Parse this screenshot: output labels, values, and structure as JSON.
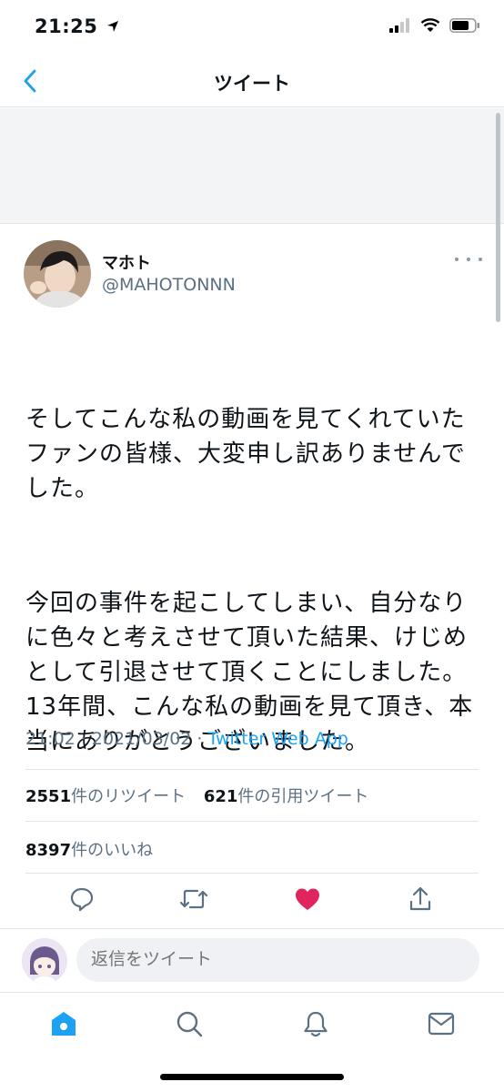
{
  "status_bar": {
    "time": "21:25"
  },
  "nav": {
    "title": "ツイート"
  },
  "tweet": {
    "display_name": "マホト",
    "handle": "@MAHOTONNN",
    "paragraph_1": "そしてこんな私の動画を見てくれていたファンの皆様、大変申し訳ありませんでした。",
    "paragraph_2": "今回の事件を起こしてしまい、自分なりに色々と考えさせて頂いた結果、けじめとして引退させて頂くことにしました。\n13年間、こんな私の動画を見て頂き、本当にありがとうございました。",
    "timestamp": "21:02 · 2021/03/02 · ",
    "source": "Twitter Web App"
  },
  "stats": {
    "retweet_count": "2551",
    "retweet_label": "件のリツイート",
    "quote_count": "621",
    "quote_label": "件の引用ツイート",
    "like_count": "8397",
    "like_label": "件のいいね"
  },
  "composer": {
    "placeholder": "返信をツイート"
  },
  "colors": {
    "accent": "#1da1f2",
    "like": "#e0245e",
    "icon": "#5b7083"
  },
  "icons": {
    "actions": [
      "reply-icon",
      "retweet-icon",
      "like-icon",
      "share-icon"
    ],
    "tabs": [
      "home-icon",
      "search-icon",
      "notifications-icon",
      "messages-icon"
    ]
  }
}
